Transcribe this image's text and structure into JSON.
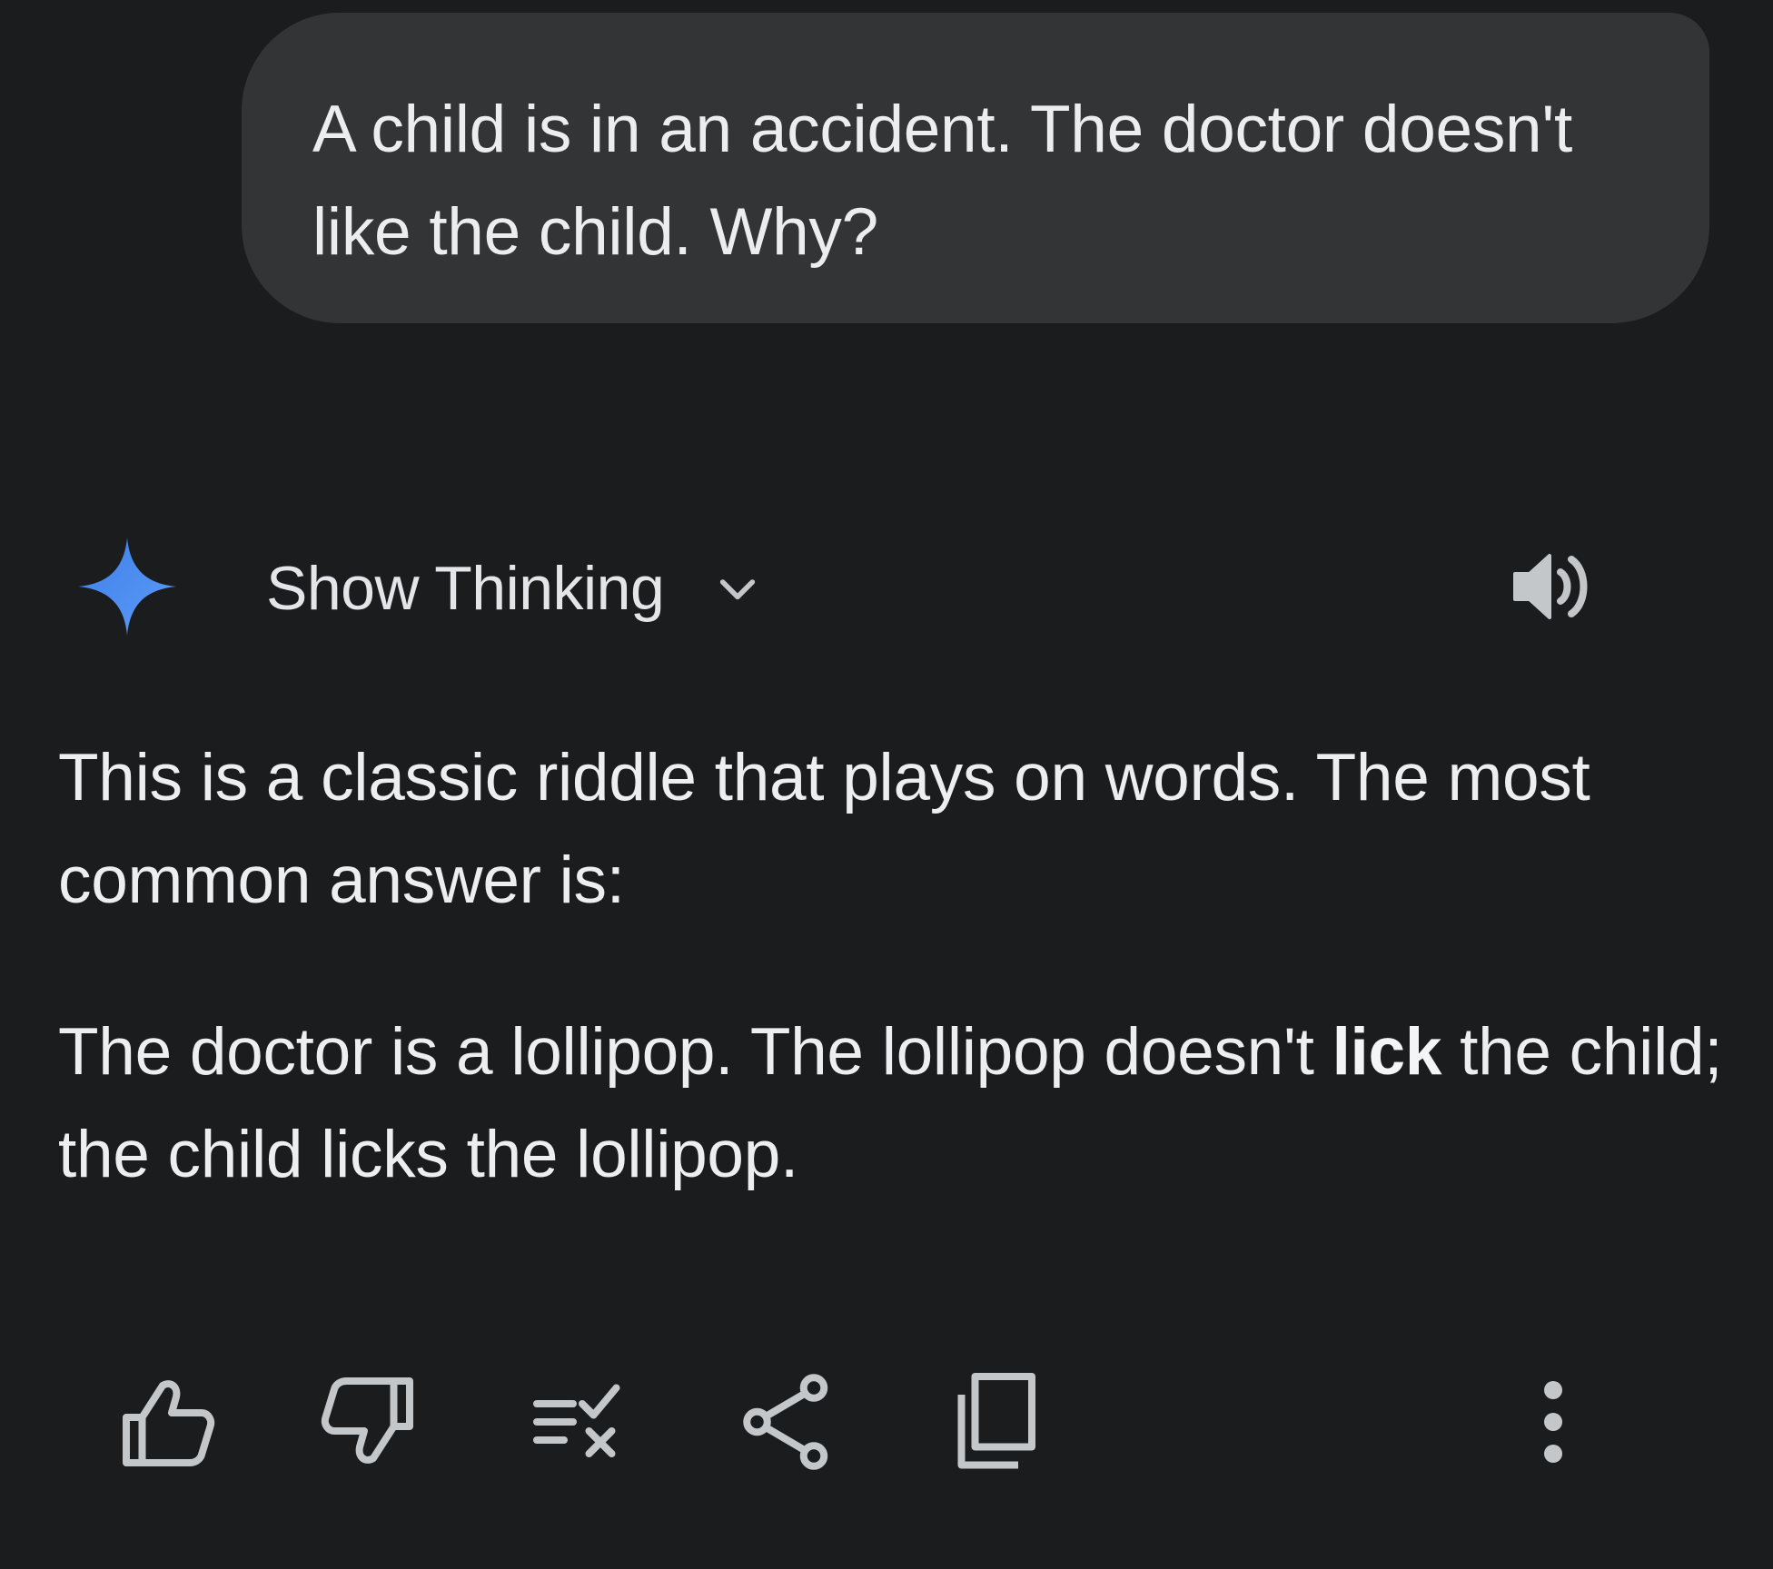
{
  "user_message": {
    "text": "A child is in an accident. The doctor doesn't like the child. Why?"
  },
  "model_response": {
    "icon": "gemini-sparkle-icon",
    "show_thinking_label": "Show Thinking",
    "paragraph1": "This is a classic riddle that plays on words. The most common answer is:",
    "paragraph2_before": "The doctor is a lollipop. The lollipop doesn't ",
    "paragraph2_bold": "lick",
    "paragraph2_after": " the child; the child licks the lollipop."
  },
  "actions": [
    {
      "name": "thumbs-up-icon"
    },
    {
      "name": "thumbs-down-icon"
    },
    {
      "name": "double-check-icon"
    },
    {
      "name": "share-icon"
    },
    {
      "name": "copy-icon"
    },
    {
      "name": "more-options-icon"
    }
  ],
  "colors": {
    "background": "#1b1c1e",
    "bubble": "#333436",
    "text": "#e6e8ea",
    "icon": "#c4c7ca",
    "gemini_blue": "#4a8bf5"
  }
}
